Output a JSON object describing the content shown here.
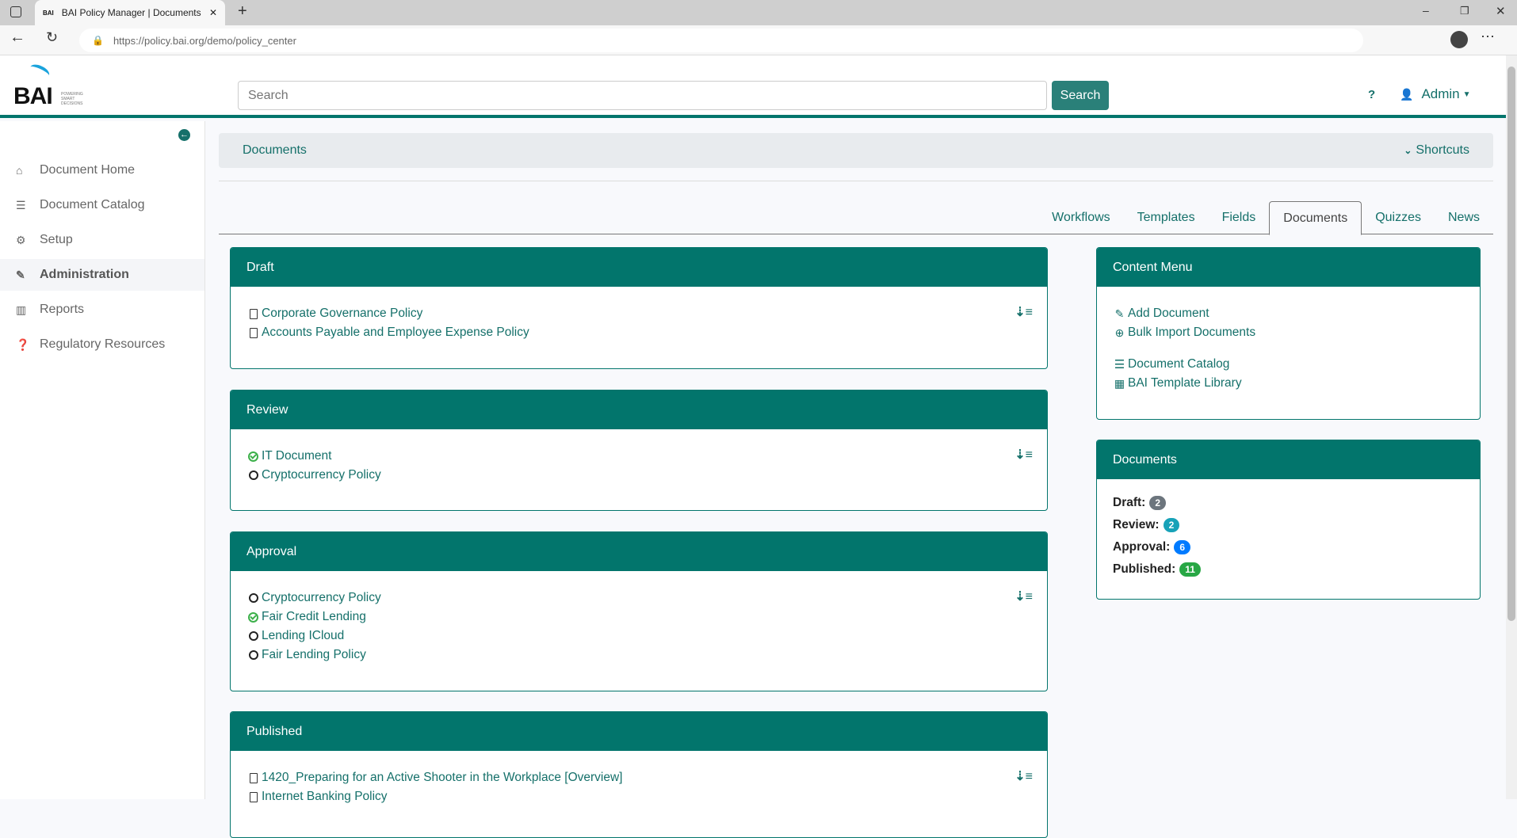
{
  "browser": {
    "tab_title": "BAI Policy Manager | Documents",
    "url": "https://policy.bai.org/demo/policy_center"
  },
  "header": {
    "logo_text": "BAI",
    "logo_tagline": "POWERING SMART DECISIONS",
    "search_placeholder": "Search",
    "search_button": "Search",
    "help_label": "?",
    "user_label": "Admin"
  },
  "sidebar": {
    "items": [
      {
        "label": "Document Home",
        "icon": "home-icon"
      },
      {
        "label": "Document Catalog",
        "icon": "list-icon"
      },
      {
        "label": "Setup",
        "icon": "gears-icon"
      },
      {
        "label": "Administration",
        "icon": "pencil-icon",
        "active": true
      },
      {
        "label": "Reports",
        "icon": "bar-chart-icon"
      },
      {
        "label": "Regulatory Resources",
        "icon": "question-circle-icon"
      }
    ]
  },
  "breadcrumb": {
    "title": "Documents",
    "shortcuts": "Shortcuts"
  },
  "tabs": [
    "Workflows",
    "Templates",
    "Fields",
    "Documents",
    "Quizzes",
    "News"
  ],
  "panels": {
    "draft": {
      "title": "Draft",
      "items": [
        "Corporate Governance Policy",
        "Accounts Payable and Employee Expense Policy"
      ]
    },
    "review": {
      "title": "Review",
      "items": [
        "IT Document",
        "Cryptocurrency Policy"
      ]
    },
    "approval": {
      "title": "Approval",
      "items": [
        "Cryptocurrency Policy",
        "Fair Credit Lending",
        "Lending ICloud",
        "Fair Lending Policy"
      ]
    },
    "published": {
      "title": "Published",
      "items": [
        "1420_Preparing for an Active Shooter in the Workplace [Overview]",
        "Internet Banking Policy"
      ]
    }
  },
  "content_menu": {
    "title": "Content Menu",
    "items": [
      "Add Document",
      "Bulk Import Documents",
      "Document Catalog",
      "BAI Template Library"
    ]
  },
  "documents_summary": {
    "title": "Documents",
    "stats": [
      {
        "label": "Draft:",
        "count": "2",
        "color": "#6c757d"
      },
      {
        "label": "Review:",
        "count": "2",
        "color": "#17a2b8"
      },
      {
        "label": "Approval:",
        "count": "6",
        "color": "#007bff"
      },
      {
        "label": "Published:",
        "count": "11",
        "color": "#28a745"
      }
    ]
  }
}
